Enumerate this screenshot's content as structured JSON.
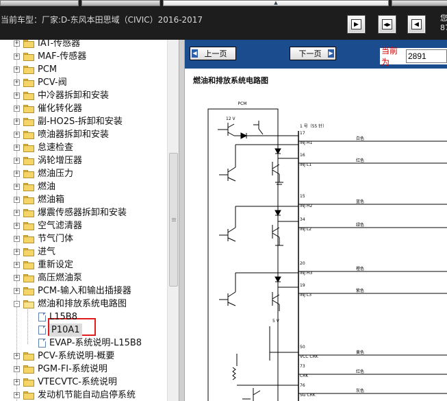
{
  "top_menu": {
    "center_glyph": "▲"
  },
  "vehicle_line": "当前车型：厂家:D-东风本田思域（CIVIC）2016-2017",
  "top_right_truncated": "您 87",
  "view_buttons": [
    {
      "name": "single-page",
      "glyph": "▶"
    },
    {
      "name": "fit-width",
      "glyph": "◀▶"
    },
    {
      "name": "fit-page",
      "glyph": "◀"
    }
  ],
  "tree": {
    "items": [
      {
        "label": "IAT-传感器",
        "kind": "folder",
        "expander": "+"
      },
      {
        "label": "MAF-传感器",
        "kind": "folder",
        "expander": "+"
      },
      {
        "label": "PCM",
        "kind": "folder",
        "expander": "+"
      },
      {
        "label": "PCV-阀",
        "kind": "folder",
        "expander": "+"
      },
      {
        "label": "中冷器拆卸和安装",
        "kind": "folder",
        "expander": "+"
      },
      {
        "label": "催化转化器",
        "kind": "folder",
        "expander": "+"
      },
      {
        "label": "副-HO2S-拆卸和安装",
        "kind": "folder",
        "expander": "+"
      },
      {
        "label": "喷油器拆卸和安装",
        "kind": "folder",
        "expander": "+"
      },
      {
        "label": "怠速检查",
        "kind": "folder",
        "expander": "+"
      },
      {
        "label": "涡轮增压器",
        "kind": "folder",
        "expander": "+"
      },
      {
        "label": "燃油压力",
        "kind": "folder",
        "expander": "+"
      },
      {
        "label": "燃油",
        "kind": "folder",
        "expander": "+"
      },
      {
        "label": "燃油箱",
        "kind": "folder",
        "expander": "+"
      },
      {
        "label": "爆震传感器拆卸和安装",
        "kind": "folder",
        "expander": "+"
      },
      {
        "label": "空气滤清器",
        "kind": "folder",
        "expander": "+"
      },
      {
        "label": "节气门体",
        "kind": "folder",
        "expander": "+"
      },
      {
        "label": "进气",
        "kind": "folder",
        "expander": "+"
      },
      {
        "label": "重新设定",
        "kind": "folder",
        "expander": "+"
      },
      {
        "label": "高压燃油泵",
        "kind": "folder",
        "expander": "+"
      },
      {
        "label": "PCM-输入和输出插接器",
        "kind": "folder",
        "expander": "+"
      },
      {
        "label": "燃油和排放系统电路图",
        "kind": "folder-open",
        "expander": "-"
      },
      {
        "label": "L15B8",
        "kind": "doc"
      },
      {
        "label": "P10A1",
        "kind": "doc",
        "selected": true
      },
      {
        "label": "EVAP-系统说明-L15B8",
        "kind": "doc"
      },
      {
        "label": "PCV-系统说明-概要",
        "kind": "folder",
        "expander": "+"
      },
      {
        "label": "PGM-FI-系统说明",
        "kind": "folder",
        "expander": "+"
      },
      {
        "label": "VTECVTC-系统说明",
        "kind": "folder",
        "expander": "+"
      },
      {
        "label": "发动机节能自动启停系统",
        "kind": "folder",
        "expander": "+"
      }
    ]
  },
  "viewer": {
    "prev_label": "上一页",
    "next_label": "下一页",
    "prev_arrow": "◀",
    "next_arrow": "▶",
    "page_label": "当前为",
    "page_value": "2891",
    "doc_title": "燃油和排放系统电路图"
  },
  "schematic": {
    "pcm_label": "PCM",
    "voltage_top": "12 V",
    "voltage_bottom": "5 V",
    "connector_label": "1 号（55 针）",
    "pins": [
      {
        "pin": "17",
        "signal": "INJ H1",
        "color": "白色"
      },
      {
        "pin": "16",
        "signal": "INJ L1",
        "color": "红色"
      },
      {
        "pin": "15",
        "signal": "INJ H2",
        "color": "蓝色"
      },
      {
        "pin": "34",
        "signal": "INJ L2",
        "color": "绿色"
      },
      {
        "pin": "20",
        "signal": "INJ H3",
        "color": "橙色"
      },
      {
        "pin": "19",
        "signal": "INJ L3",
        "color": "紫色"
      },
      {
        "pin": "50",
        "signal": "VCC CRK",
        "color": "黄色"
      },
      {
        "pin": "73",
        "signal": "CRK",
        "color": "红色"
      },
      {
        "pin": "76",
        "signal": "SG CRK",
        "color": "灰色"
      }
    ]
  }
}
